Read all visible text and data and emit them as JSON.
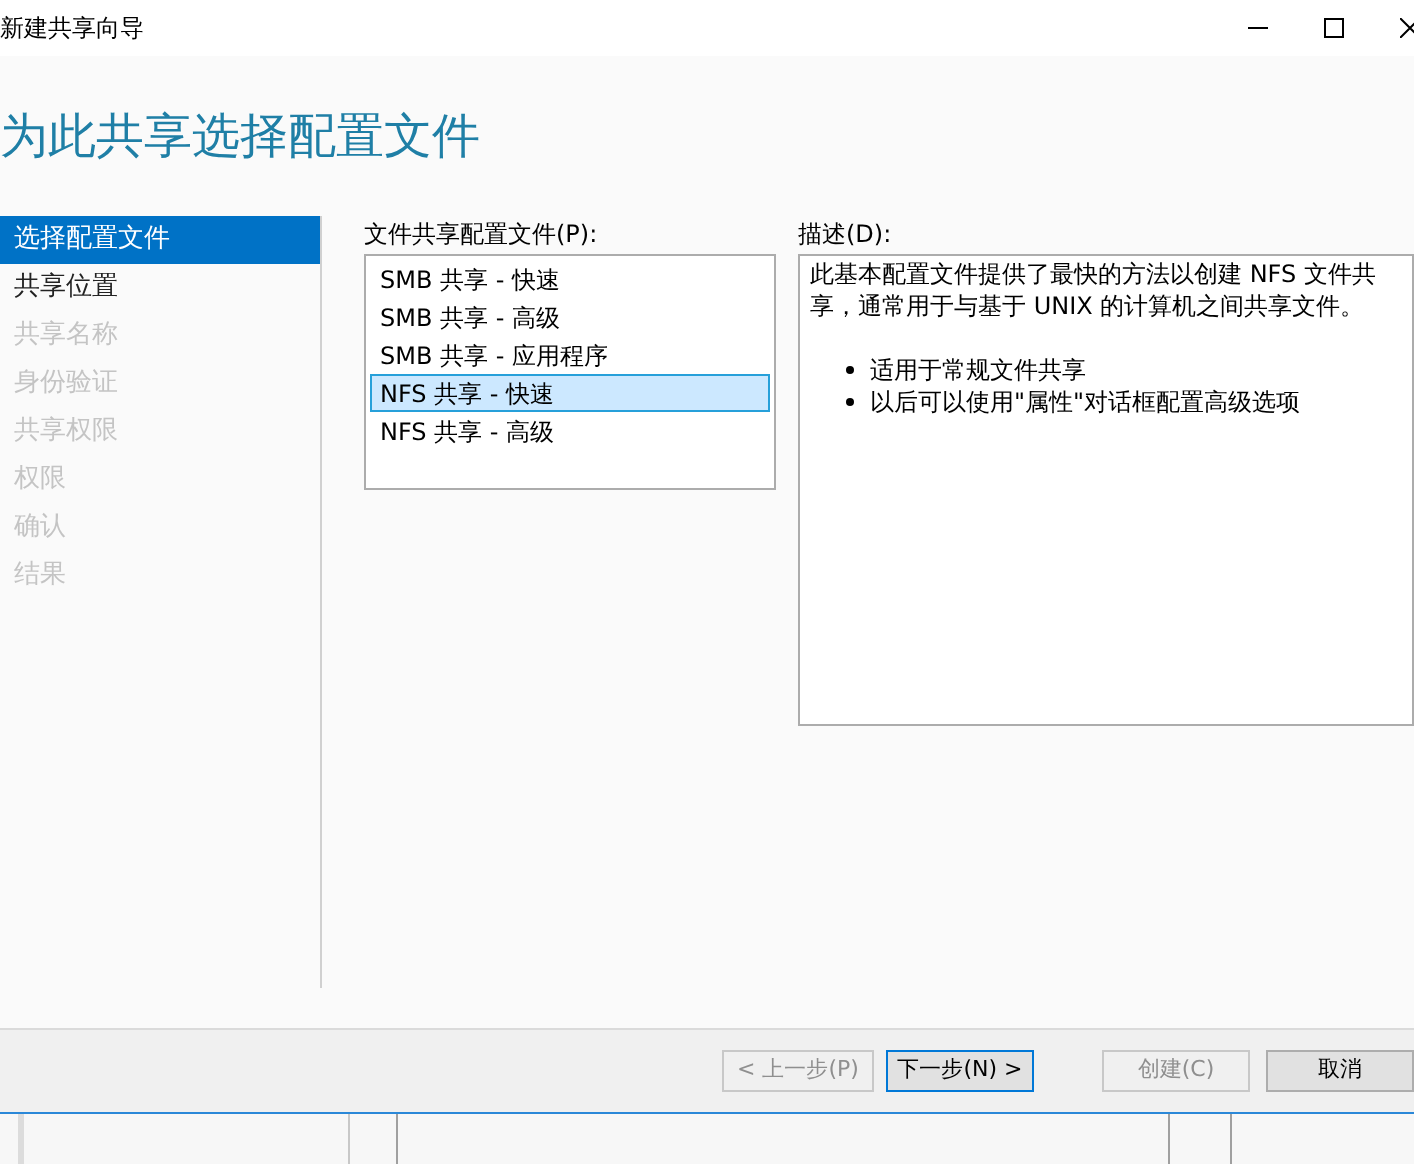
{
  "window": {
    "title": "新建共享向导"
  },
  "page_title": "为此共享选择配置文件",
  "steps": [
    {
      "label": "选择配置文件",
      "selected": true,
      "disabled": false
    },
    {
      "label": "共享位置",
      "selected": false,
      "disabled": false
    },
    {
      "label": "共享名称",
      "selected": false,
      "disabled": true
    },
    {
      "label": "身份验证",
      "selected": false,
      "disabled": true
    },
    {
      "label": "共享权限",
      "selected": false,
      "disabled": true
    },
    {
      "label": "权限",
      "selected": false,
      "disabled": true
    },
    {
      "label": "确认",
      "selected": false,
      "disabled": true
    },
    {
      "label": "结果",
      "selected": false,
      "disabled": true
    }
  ],
  "profiles": {
    "label": "文件共享配置文件(P):",
    "items": [
      {
        "label": "SMB 共享 - 快速",
        "selected": false
      },
      {
        "label": "SMB 共享 - 高级",
        "selected": false
      },
      {
        "label": "SMB 共享 - 应用程序",
        "selected": false
      },
      {
        "label": "NFS 共享 - 快速",
        "selected": true
      },
      {
        "label": "NFS 共享 - 高级",
        "selected": false
      }
    ]
  },
  "description": {
    "label": "描述(D):",
    "text": "此基本配置文件提供了最快的方法以创建 NFS 文件共享，通常用于与基于 UNIX 的计算机之间共享文件。",
    "bullets": [
      "适用于常规文件共享",
      "以后可以使用\"属性\"对话框配置高级选项"
    ]
  },
  "buttons": [
    {
      "label": "< 上一步(P)",
      "disabled": true,
      "default": false
    },
    {
      "label": "下一步(N) >",
      "disabled": false,
      "default": true
    },
    {
      "label": "创建(C)",
      "disabled": true,
      "default": false
    },
    {
      "label": "取消",
      "disabled": false,
      "default": false
    }
  ]
}
